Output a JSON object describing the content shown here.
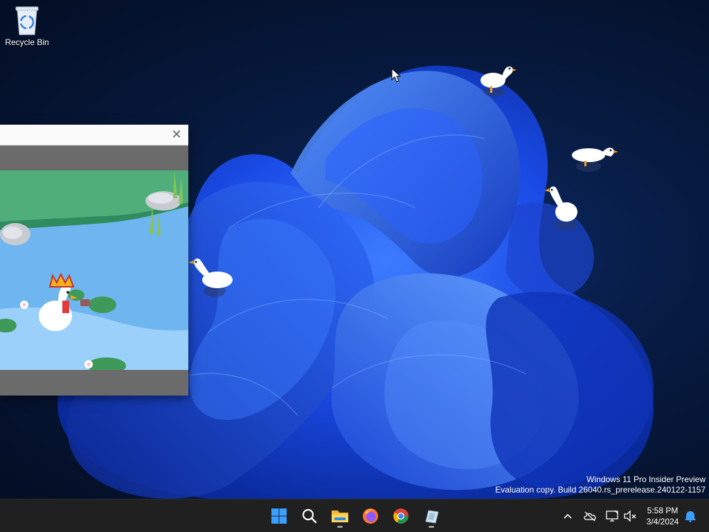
{
  "desktop": {
    "icons": [
      {
        "label": "Recycle Bin",
        "icon": "recycle-bin-icon"
      }
    ],
    "watermark": {
      "line1": "Windows 11 Pro Insider Preview",
      "line2": "Evaluation copy. Build 26040.rs_prerelease.240122-1157"
    }
  },
  "game_window": {
    "close_glyph": "✕",
    "scene": "goose-with-crown-in-pond"
  },
  "taskbar": {
    "apps": [
      {
        "icon": "windows-start-icon"
      },
      {
        "icon": "search-icon"
      },
      {
        "icon": "file-explorer-icon",
        "running": true
      },
      {
        "icon": "firefox-icon"
      },
      {
        "icon": "chrome-icon"
      },
      {
        "icon": "desktop-goose-app-icon",
        "running": true
      }
    ],
    "tray": {
      "icons": [
        "chevron-up-icon",
        "onedrive-offline-icon",
        "network-icon",
        "volume-muted-icon",
        "notifications-bell-icon"
      ]
    },
    "clock": {
      "time": "5:58 PM",
      "date": "3/4/2024"
    }
  },
  "colors": {
    "taskbar_bg": "#202020",
    "accent": "#1f6feb",
    "wallpaper_blue": "#1a4be6"
  }
}
